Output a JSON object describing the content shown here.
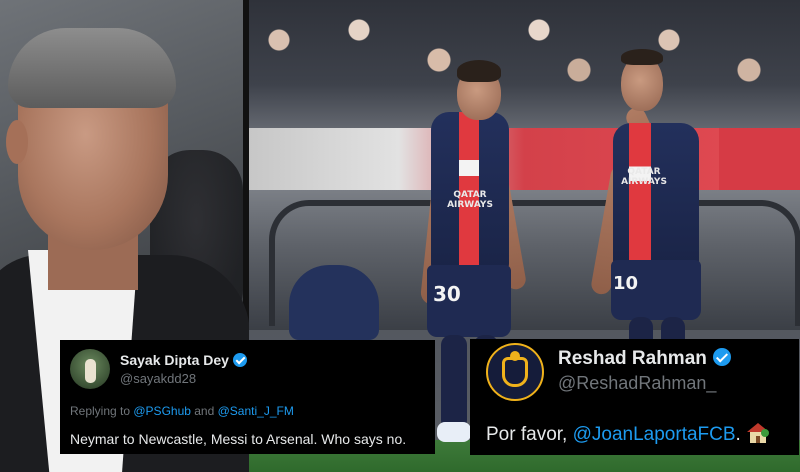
{
  "tweets": {
    "left": {
      "name": "Sayak Dipta Dey",
      "handle": "@sayakdd28",
      "replying_prefix": "Replying to ",
      "reply_to_1": "@PSGhub",
      "reply_and": " and ",
      "reply_to_2": "@Santi_J_FM",
      "text": "Neymar to Newcastle, Messi to Arsenal. Who says no."
    },
    "right": {
      "name": "Reshad Rahman",
      "handle": "@ReshadRahman_",
      "text_prefix": "Por favor, ",
      "mention": "@JoanLaportaFCB",
      "text_suffix": "."
    }
  },
  "photo": {
    "player_left_number": "30",
    "player_right_number": "10",
    "sponsor": "QATAR AIRWAYS"
  },
  "colors": {
    "verified": "#1d9bf0",
    "link": "#1d9bf0",
    "card_bg": "#000000",
    "psg_navy": "#1f2a52",
    "psg_red": "#e0393f"
  },
  "icons": {
    "verified": "verified-badge-icon",
    "emoji": "house-with-garden-icon"
  }
}
